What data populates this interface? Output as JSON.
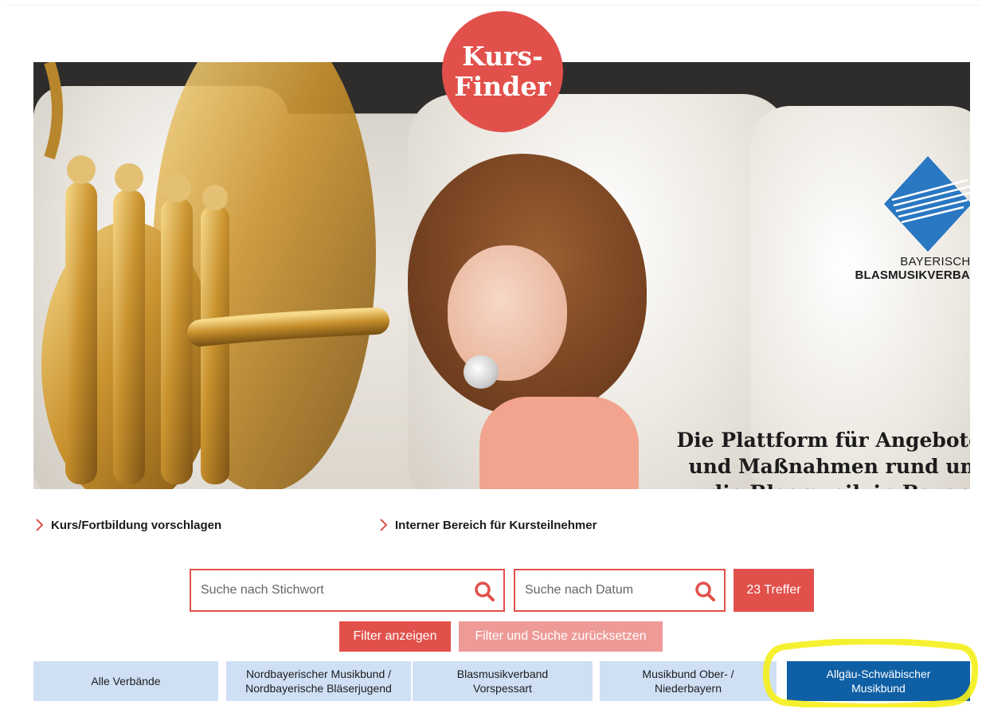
{
  "hero": {
    "badge": "Kurs-\nFinder",
    "logo_line1": "BAYERISCHER",
    "logo_line2": "BLASMUSIKVERBAND",
    "claim_line1": "Die Plattform für Angebote",
    "claim_line2": "und Maßnahmen rund um",
    "claim_line3": "die Blasmusik in Bayern"
  },
  "links": {
    "suggest": "Kurs/Fortbildung vorschlagen",
    "internal": "Interner Bereich für Kursteilnehmer"
  },
  "search": {
    "keyword_placeholder": "Suche nach Stichwort",
    "date_placeholder": "Suche nach Datum",
    "hits_label": "23 Treffer",
    "show_filter_label": "Filter anzeigen",
    "reset_label": "Filter und Suche zurücksetzen"
  },
  "tabs": [
    {
      "label": "Alle Verbände",
      "active": false
    },
    {
      "label": "Nordbayerischer Musikbund /\nNordbayerische Bläserjugend",
      "active": false
    },
    {
      "label": "Blasmusikverband\nVorspessart",
      "active": false
    },
    {
      "label": "Musikbund Ober- /\nNiederbayern",
      "active": false
    },
    {
      "label": "Allgäu-Schwäbischer\nMusikbund",
      "active": true
    }
  ],
  "colors": {
    "accent_red": "#e2504b",
    "light_red": "#ee9a97",
    "tab_blue_light": "#cfe0f5",
    "tab_blue_active": "#0e5fa4",
    "highlight_yellow": "#f5ef1a"
  },
  "icons": {
    "search": "magnifier-icon",
    "link_arrow": "chevron-right-icon"
  }
}
